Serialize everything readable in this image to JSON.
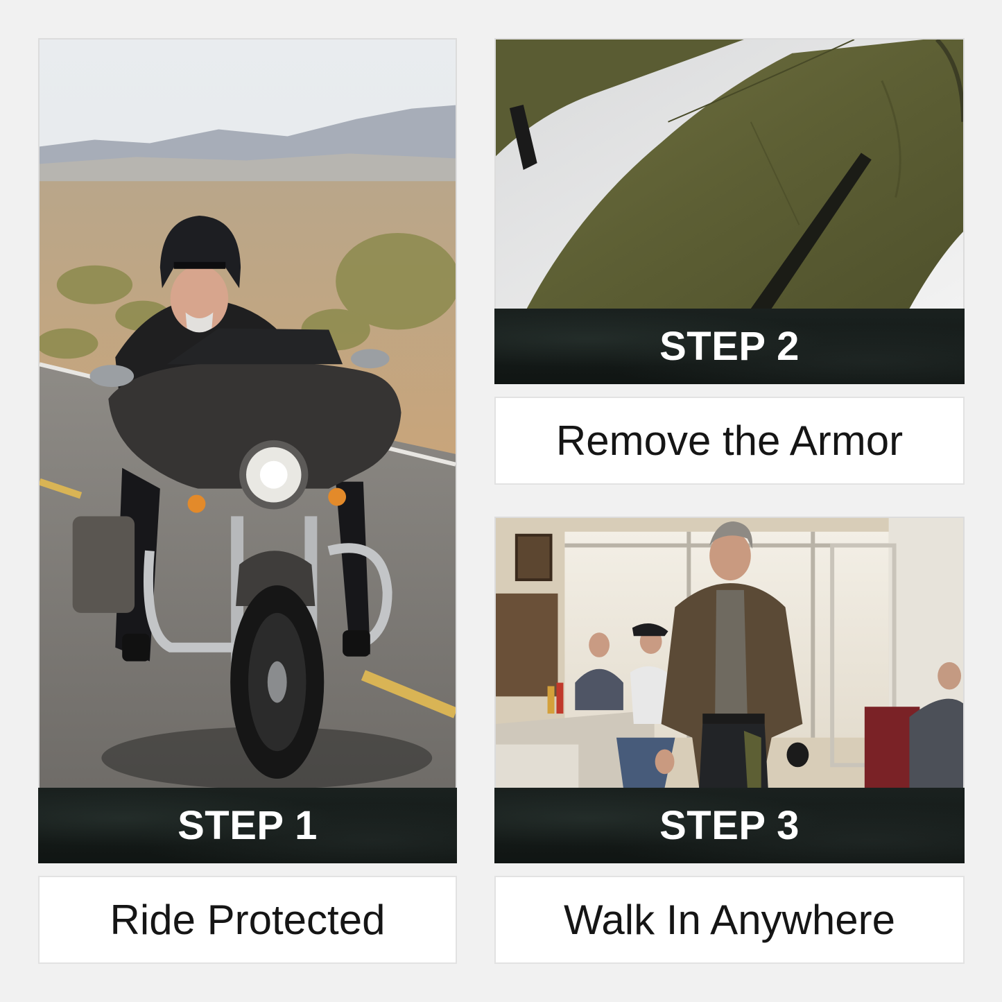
{
  "steps": [
    {
      "label": "STEP 1",
      "caption": "Ride Protected"
    },
    {
      "label": "STEP 2",
      "caption": "Remove the Armor"
    },
    {
      "label": "STEP 3",
      "caption": "Walk In Anywhere"
    }
  ],
  "colors": {
    "background": "#f1f1f1",
    "banner": "#131a18",
    "banner_text": "#ffffff",
    "caption_text": "#151515",
    "caption_box": "#ffffff"
  }
}
